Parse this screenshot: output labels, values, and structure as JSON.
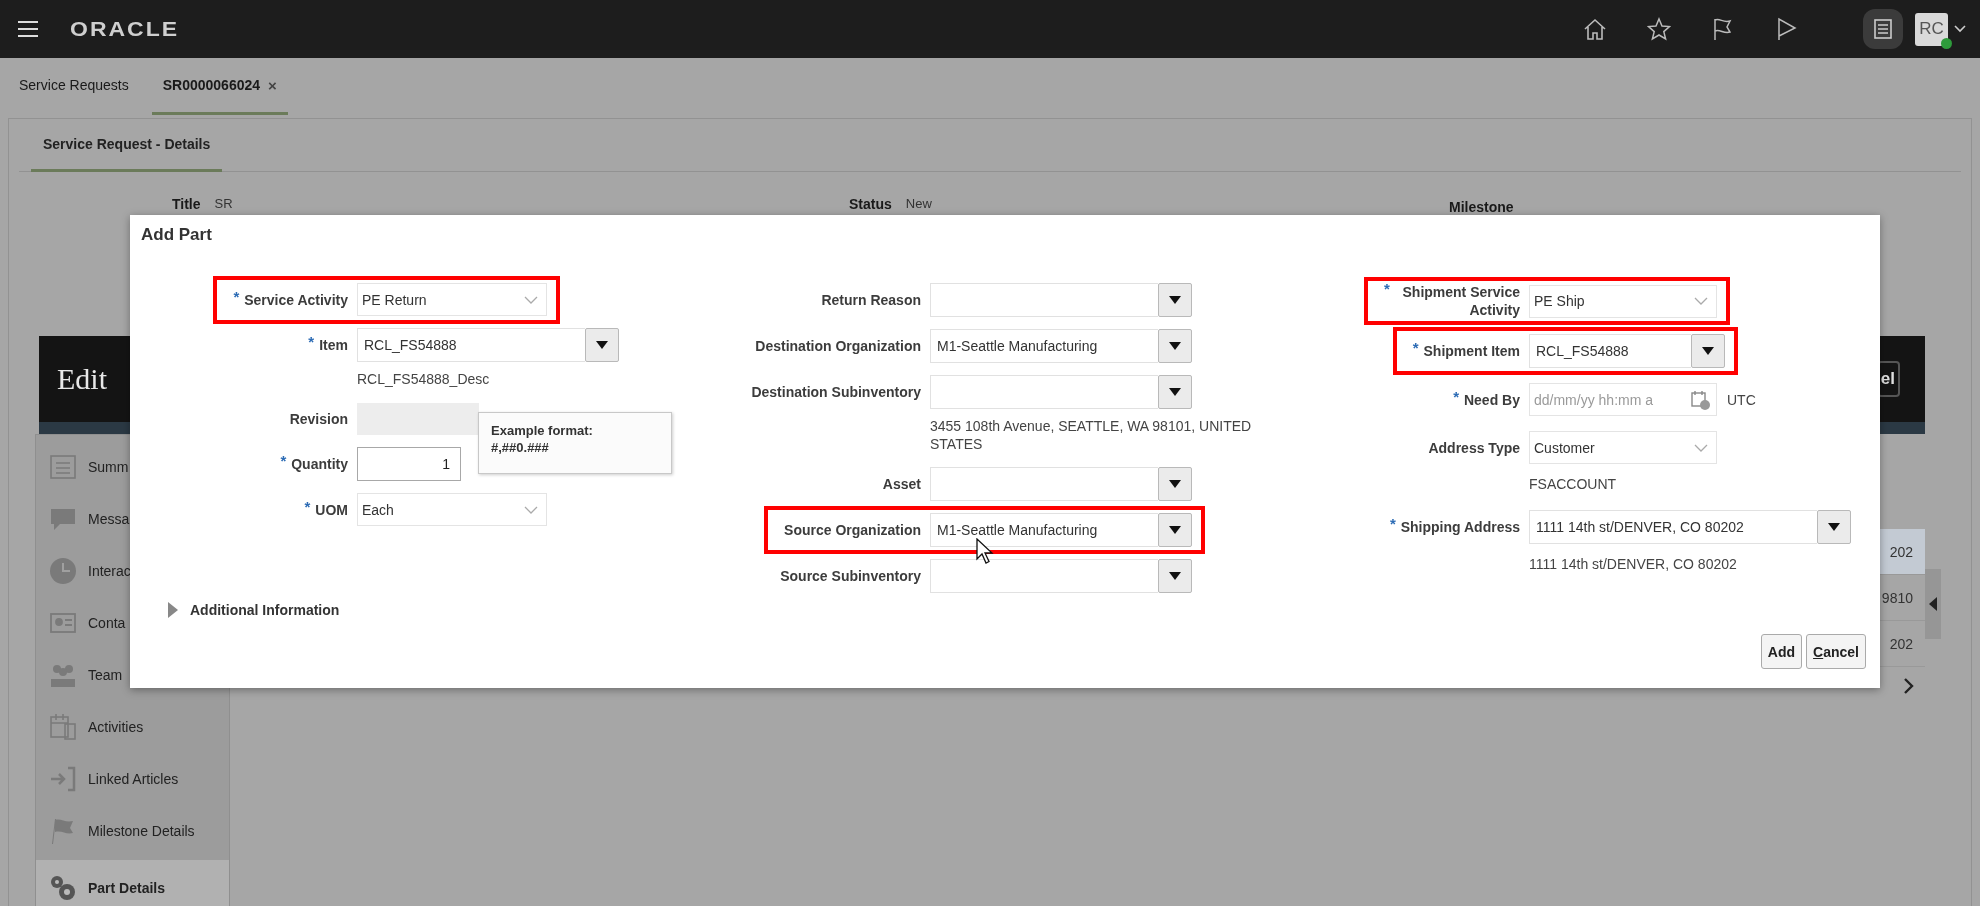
{
  "header": {
    "logo": "ORACLE",
    "avatar": {
      "initials": "RC",
      "online": true
    }
  },
  "tabs": [
    {
      "label": "Service Requests",
      "selected": false
    },
    {
      "label": "SR0000066024",
      "selected": true,
      "close": "×"
    }
  ],
  "subtabs": [
    {
      "label": "Service Request - Details",
      "selected": true
    }
  ],
  "summary": [
    {
      "label": "Title",
      "value": "SR"
    },
    {
      "label": "Status",
      "value": "New"
    },
    {
      "label": "Milestone"
    }
  ],
  "banner": {
    "title": "Edit",
    "button": "el"
  },
  "nav": [
    {
      "label": "Summ",
      "selected": false
    },
    {
      "label": "Messa",
      "selected": false
    },
    {
      "label": "Interac",
      "selected": false
    },
    {
      "label": "Conta",
      "selected": false
    },
    {
      "label": "Team",
      "selected": false
    },
    {
      "label": "Activities",
      "selected": false
    },
    {
      "label": "Linked Articles",
      "selected": false
    },
    {
      "label": "Milestone Details",
      "selected": false
    },
    {
      "label": "Part Details",
      "selected": true
    }
  ],
  "background_rows": [
    {
      "text": "202",
      "selected": true
    },
    {
      "text": "9810",
      "selected": false
    },
    {
      "text": "202",
      "selected": false
    }
  ],
  "dialog": {
    "title": "Add Part",
    "required_symbol": "*",
    "columns": [
      [
        {
          "kind": "select",
          "label": "Service Activity",
          "required": true,
          "value": "PE Return",
          "highlighted": true
        },
        {
          "kind": "lov",
          "label": "Item",
          "required": true,
          "value": "RCL_FS54888",
          "highlighted": false
        },
        {
          "kind": "note",
          "value": "RCL_FS54888_Desc"
        },
        {
          "kind": "readonly",
          "label": "Revision",
          "required": false,
          "highlighted": false
        },
        {
          "kind": "number",
          "label": "Quantity",
          "required": true,
          "value": "1",
          "highlighted": false
        },
        {
          "kind": "select",
          "label": "UOM",
          "required": true,
          "value": "Each",
          "highlighted": false
        }
      ],
      [
        {
          "kind": "lov",
          "label": "Return Reason",
          "required": false,
          "highlighted": false
        },
        {
          "kind": "lov",
          "label": "Destination Organization",
          "required": false,
          "value": "M1-Seattle Manufacturing",
          "highlighted": false
        },
        {
          "kind": "lov",
          "label": "Destination Subinventory",
          "required": false,
          "highlighted": false
        },
        {
          "kind": "note",
          "value": "3455 108th Avenue, SEATTLE, WA 98101, UNITED STATES"
        },
        {
          "kind": "lov",
          "label": "Asset",
          "required": false,
          "highlighted": false
        },
        {
          "kind": "lov",
          "label": "Source Organization",
          "required": false,
          "value": "M1-Seattle Manufacturing",
          "highlighted": true
        },
        {
          "kind": "lov",
          "label": "Source Subinventory",
          "required": false,
          "highlighted": false
        }
      ],
      [
        {
          "kind": "select",
          "label": "Shipment Service Activity",
          "required": true,
          "value": "PE Ship",
          "highlighted": true
        },
        {
          "kind": "lov",
          "label": "Shipment Item",
          "required": true,
          "value": "RCL_FS54888",
          "highlighted": true
        },
        {
          "kind": "date",
          "label": "Need By",
          "required": true,
          "placeholder": "dd/mm/yy hh:mm a",
          "suffix": "UTC",
          "highlighted": false
        },
        {
          "kind": "select",
          "label": "Address Type",
          "required": false,
          "value": "Customer",
          "highlighted": false
        },
        {
          "kind": "note",
          "value": "FSACCOUNT"
        },
        {
          "kind": "lov",
          "label": "Shipping Address",
          "required": true,
          "value": "1111 14th st/DENVER, CO 80202",
          "highlighted": false
        },
        {
          "kind": "note",
          "value": "1111 14th st/DENVER, CO 80202"
        }
      ]
    ],
    "tooltip": {
      "lines": [
        "Example format:",
        "#,##0.###"
      ]
    },
    "disclosure": {
      "label": "Additional Information",
      "expanded": false
    },
    "buttons": [
      {
        "label": "Add",
        "mnemonic": false
      },
      {
        "label": "Cancel",
        "mnemonic": true
      }
    ]
  }
}
